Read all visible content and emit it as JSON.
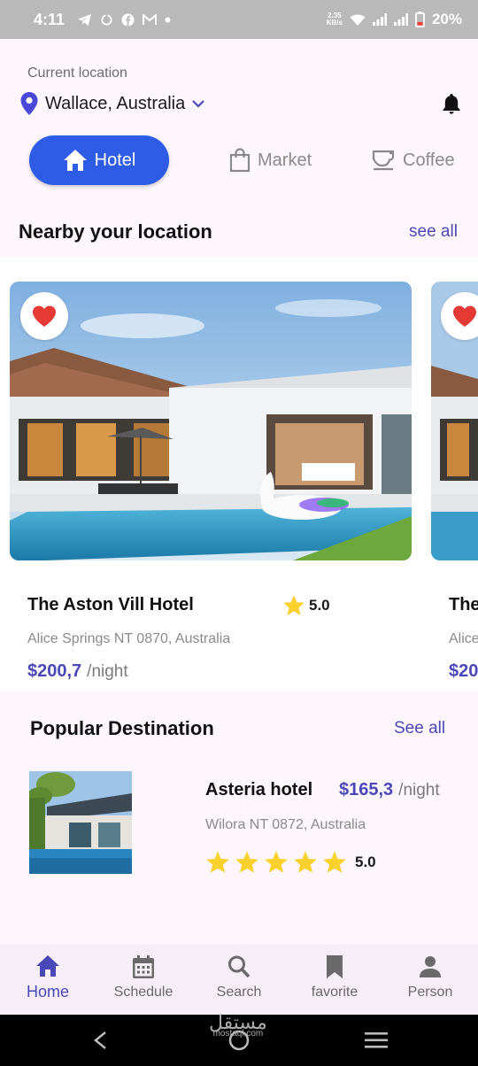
{
  "status_bar": {
    "time": "4:11",
    "speed_value": "2.35",
    "speed_unit": "KB/s",
    "battery": "20%"
  },
  "header": {
    "location_label": "Current location",
    "location_value": "Wallace, Australia"
  },
  "categories": [
    {
      "label": "Hotel",
      "icon": "home-icon",
      "active": true
    },
    {
      "label": "Market",
      "icon": "shopping-bag-icon",
      "active": false
    },
    {
      "label": "Coffee",
      "icon": "coffee-cup-icon",
      "active": false
    }
  ],
  "nearby": {
    "title": "Nearby your location",
    "see_all": "see all",
    "cards": [
      {
        "name": "The Aston Vill Hotel",
        "rating": "5.0",
        "address": "Alice Springs NT 0870, Australia",
        "price": "$200,7",
        "per": "/night",
        "favorite": true
      },
      {
        "name": "The",
        "address": "Alice",
        "price": "$20",
        "favorite": true
      }
    ]
  },
  "popular": {
    "title": "Popular Destination",
    "see_all": "See all",
    "items": [
      {
        "name": "Asteria hotel",
        "price": "$165,3",
        "per": "/night",
        "address": "Wilora NT 0872, Australia",
        "stars": 5,
        "rating": "5.0"
      }
    ]
  },
  "bottom_nav": [
    {
      "label": "Home",
      "icon": "home-icon",
      "active": true
    },
    {
      "label": "Schedule",
      "icon": "calendar-icon"
    },
    {
      "label": "Search",
      "icon": "search-icon"
    },
    {
      "label": "favorite",
      "icon": "bookmark-icon"
    },
    {
      "label": "Person",
      "icon": "person-icon"
    }
  ],
  "watermark": {
    "arabic": "مستقل",
    "latin": "mostaql.com"
  },
  "colors": {
    "accent": "#2e5ce6",
    "price": "#4a48b8",
    "heart": "#e53935",
    "star": "#f8d12c"
  }
}
